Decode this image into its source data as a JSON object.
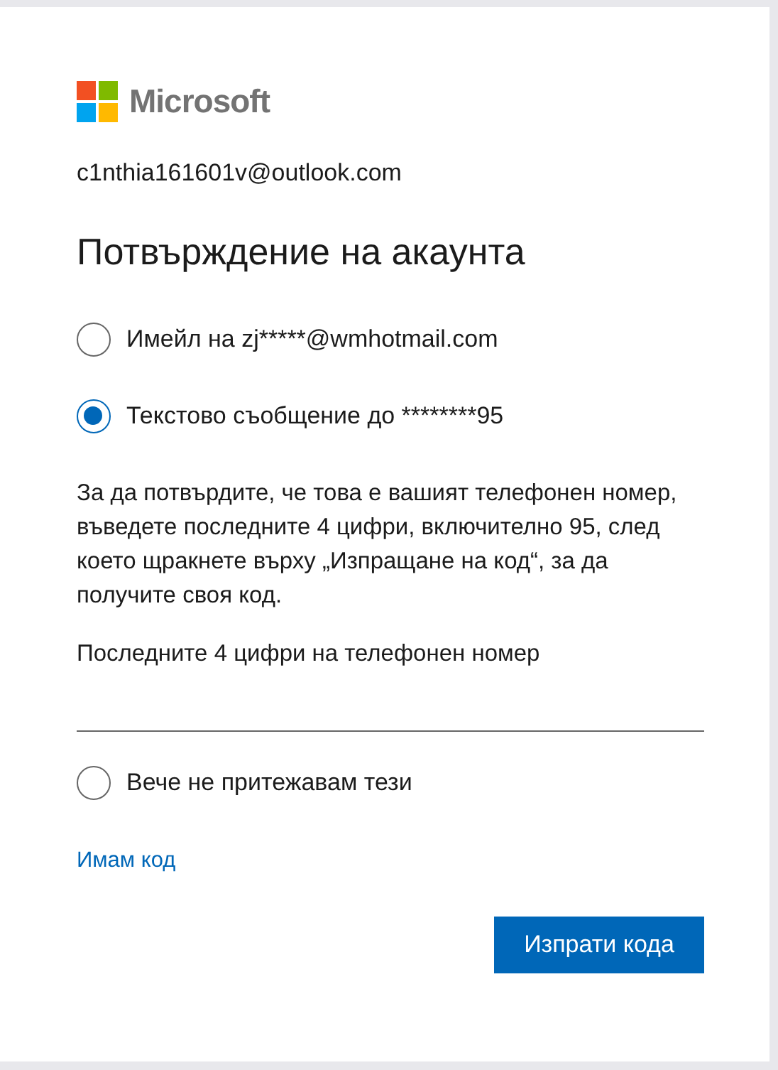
{
  "brand": {
    "name": "Microsoft"
  },
  "account": "c1nthia161601v@outlook.com",
  "title": "Потвърждение на акаунта",
  "options": [
    {
      "label": "Имейл на zj*****@wmhotmail.com",
      "selected": false
    },
    {
      "label": "Текстово съобщение до ********95",
      "selected": true
    }
  ],
  "instructions": "За да потвърдите, че това е вашият телефонен номер, въведете последните 4 цифри, включително 95, след което щракнете върху „Изпращане на код“, за да получите своя код.",
  "phone_field": {
    "label": "Последните 4 цифри на телефонен номер"
  },
  "other_option": {
    "label": "Вече не притежавам тези",
    "selected": false
  },
  "link": "Имам код",
  "button": "Изпрати кода"
}
